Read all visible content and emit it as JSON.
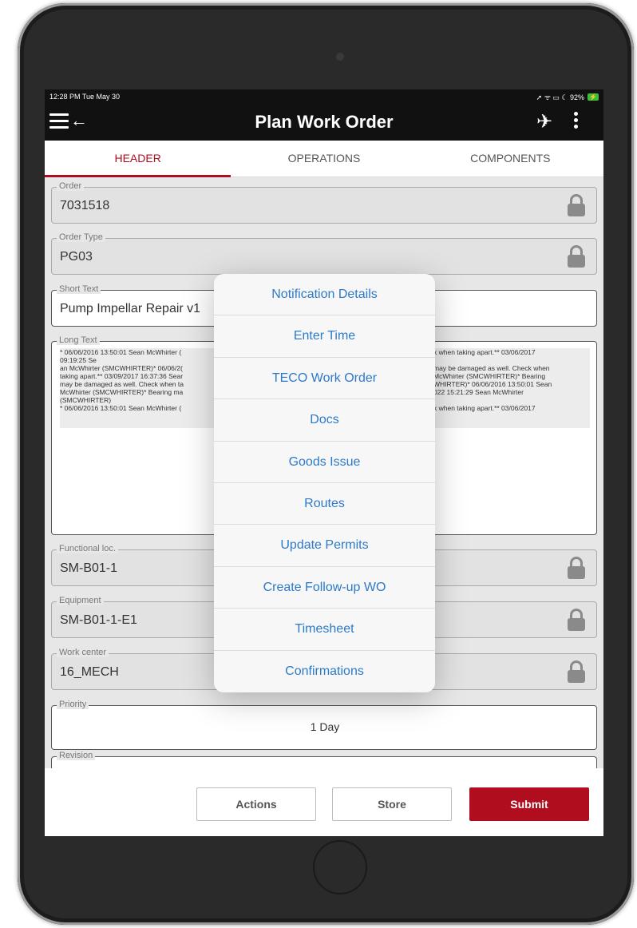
{
  "status_bar": {
    "time": "12:28 PM  Tue May 30",
    "indicators": "➚ ᯤ ▭ ☾ 92%",
    "battery_label": "⚡"
  },
  "app_bar": {
    "title": "Plan Work Order"
  },
  "tabs": [
    {
      "label": "HEADER",
      "active": true
    },
    {
      "label": "OPERATIONS",
      "active": false
    },
    {
      "label": "COMPONENTS",
      "active": false
    }
  ],
  "form": {
    "order": {
      "label": "Order",
      "value": "7031518"
    },
    "order_type": {
      "label": "Order Type",
      "value": "PG03"
    },
    "short_text": {
      "label": "Short Text",
      "value": "Pump Impellar Repair v1"
    },
    "long_text": {
      "label": "Long Text",
      "left_lines": "* 06/06/2016 13:50:01 Sean McWhirter (\n09:19:25 Se\nan McWhirter (SMCWHIRTER)* 06/06/2(\ntaking apart.** 03/09/2017 16:37:36 Sear\nmay be damaged as well. Check when ta\nMcWhirter (SMCWHIRTER)* Bearing ma\n(SMCWHIRTER)\n* 06/06/2016 13:50:01 Sean McWhirter (",
      "right_lines": "k when taking apart.** 03/06/2017\n\nmay be damaged as well. Check when\nMcWhirter (SMCWHIRTER)* Bearing\nWHIRTER)* 06/06/2016 13:50:01 Sean\n022 15:21:29 Sean McWhirter\n\nk when taking apart.** 03/06/2017"
    },
    "functional_loc": {
      "label": "Functional loc.",
      "value": "SM-B01-1"
    },
    "equipment": {
      "label": "Equipment",
      "value": "SM-B01-1-E1"
    },
    "work_center": {
      "label": "Work center",
      "value": "16_MECH"
    },
    "priority": {
      "label": "Priority",
      "value": "1 Day"
    },
    "revision": {
      "label": "Revision"
    }
  },
  "popup_menu": {
    "items": [
      "Notification Details",
      "Enter Time",
      "TECO Work Order",
      "Docs",
      "Goods Issue",
      "Routes",
      "Update Permits",
      "Create Follow-up WO",
      "Timesheet",
      "Confirmations"
    ]
  },
  "bottom_bar": {
    "actions": "Actions",
    "store": "Store",
    "submit": "Submit"
  },
  "colors": {
    "accent": "#b00d1f",
    "link": "#2d7ac9",
    "app_bar": "#111111"
  },
  "icons": [
    "menu-icon",
    "back-arrow-icon",
    "airplane-icon",
    "more-vertical-icon",
    "lock-icon",
    "camera-icon",
    "home-button"
  ]
}
